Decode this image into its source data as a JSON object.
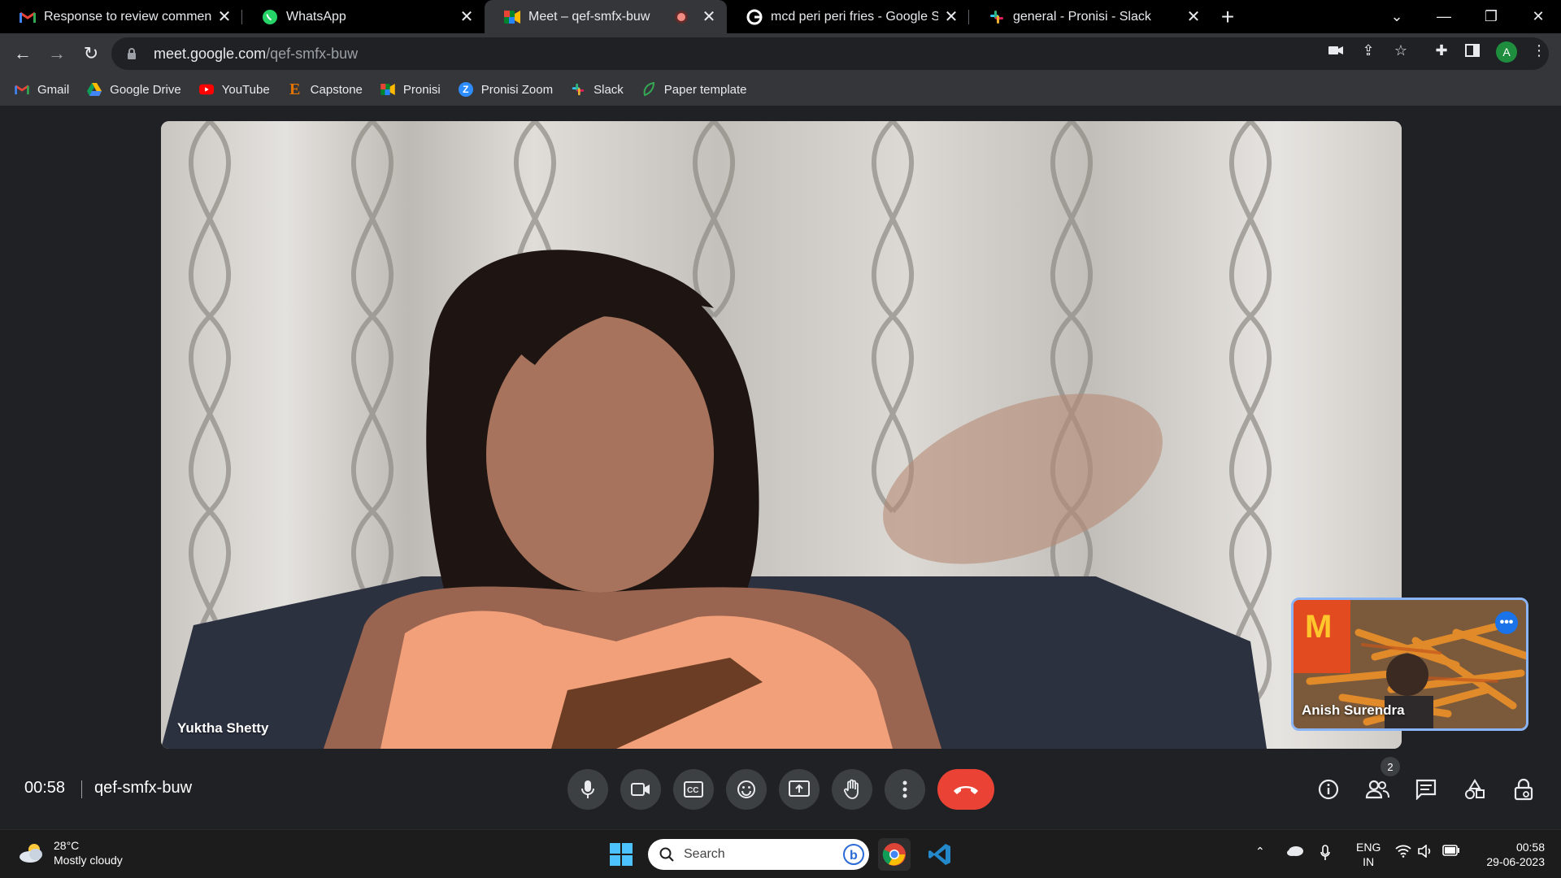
{
  "tabs": [
    {
      "title": "Response to review comments - ",
      "favicon": "gmail-icon"
    },
    {
      "title": "WhatsApp",
      "favicon": "whatsapp-icon"
    },
    {
      "title": "Meet – qef-smfx-buw",
      "favicon": "meet-icon",
      "active": true,
      "recording": true
    },
    {
      "title": "mcd peri peri fries - Google Sear",
      "favicon": "google-icon"
    },
    {
      "title": "general - Pronisi - Slack",
      "favicon": "slack-icon"
    }
  ],
  "address_bar": {
    "host": "meet.google.com",
    "path": "/qef-smfx-buw"
  },
  "profile_initial": "A",
  "bookmarks": [
    "Gmail",
    "Google Drive",
    "YouTube",
    "Capstone",
    "Pronisi",
    "Pronisi Zoom",
    "Slack",
    "Paper template"
  ],
  "meet": {
    "main_participant": "Yuktha Shetty",
    "pip_participant": "Anish Surendra",
    "time": "00:58",
    "meeting_code": "qef-smfx-buw",
    "participant_count": "2"
  },
  "taskbar": {
    "weather_temp": "28°C",
    "weather_desc": "Mostly cloudy",
    "search_placeholder": "Search",
    "lang_line1": "ENG",
    "lang_line2": "IN",
    "clock_time": "00:58",
    "clock_date": "29-06-2023"
  },
  "colors": {
    "end_call": "#ea4335",
    "pip_border": "#8ab4f8",
    "accent_blue": "#1a73e8"
  }
}
